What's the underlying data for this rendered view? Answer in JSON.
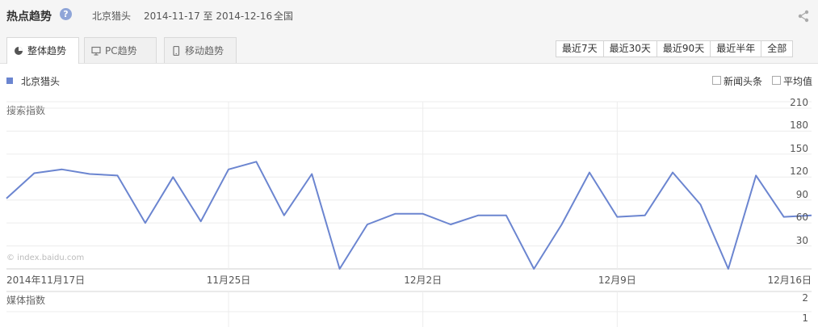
{
  "header": {
    "title": "热点趋势",
    "help_icon": "?",
    "keyword": "北京猎头",
    "date_range": "2014-11-17 至 2014-12-16",
    "region": "全国"
  },
  "tabs": [
    {
      "label": "整体趋势",
      "icon": "pie-icon"
    },
    {
      "label": "PC趋势",
      "icon": "monitor-icon"
    },
    {
      "label": "移动趋势",
      "icon": "mobile-icon"
    }
  ],
  "ranges": [
    "最近7天",
    "最近30天",
    "最近90天",
    "最近半年",
    "全部"
  ],
  "legend": {
    "series_name": "北京猎头",
    "color": "#6b85d0"
  },
  "options": {
    "news": "新闻头条",
    "average": "平均值"
  },
  "watermark": "© index.baidu.com",
  "search_axis_title": "搜索指数",
  "media_axis_title": "媒体指数",
  "chart_data": [
    {
      "type": "line",
      "ylabel": "搜索指数",
      "ylim": [
        0,
        210
      ],
      "yticks": [
        30,
        60,
        90,
        120,
        150,
        180,
        210
      ],
      "xtick_labels": [
        "2014年11月17日",
        "11月25日",
        "12月2日",
        "12月9日",
        "12月16日"
      ],
      "x": [
        "2014-11-17",
        "2014-11-18",
        "2014-11-19",
        "2014-11-20",
        "2014-11-21",
        "2014-11-22",
        "2014-11-23",
        "2014-11-24",
        "2014-11-25",
        "2014-11-26",
        "2014-11-27",
        "2014-11-28",
        "2014-11-29",
        "2014-11-30",
        "2014-12-01",
        "2014-12-02",
        "2014-12-03",
        "2014-12-04",
        "2014-12-05",
        "2014-12-06",
        "2014-12-07",
        "2014-12-08",
        "2014-12-09",
        "2014-12-10",
        "2014-12-11",
        "2014-12-12",
        "2014-12-13",
        "2014-12-14",
        "2014-12-15",
        "2014-12-16"
      ],
      "series": [
        {
          "name": "北京猎头",
          "values": [
            92,
            125,
            130,
            124,
            122,
            60,
            120,
            62,
            130,
            140,
            70,
            124,
            0,
            58,
            72,
            72,
            58,
            70,
            70,
            0,
            58,
            126,
            68,
            70,
            126,
            84,
            0,
            122,
            68,
            70
          ]
        }
      ],
      "grid": true
    },
    {
      "type": "line",
      "ylabel": "媒体指数",
      "yticks": [
        1,
        2
      ],
      "series": []
    }
  ]
}
